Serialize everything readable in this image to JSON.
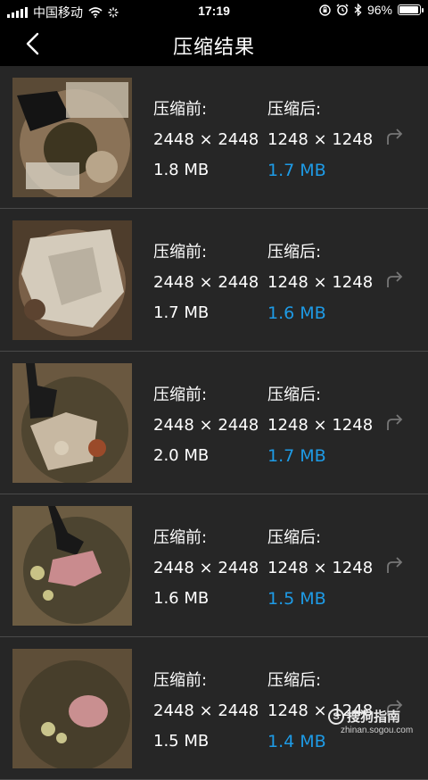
{
  "status_bar": {
    "carrier": "中国移动",
    "time": "17:19",
    "battery": "96%",
    "battery_level": 0.96,
    "icons": [
      "signal-icon",
      "wifi-icon",
      "loading-icon",
      "orientation-lock-icon",
      "alarm-icon",
      "bluetooth-icon",
      "battery-icon"
    ]
  },
  "nav": {
    "title": "压缩结果",
    "back_icon": "chevron-left-icon"
  },
  "results": [
    {
      "before_label": "压缩前:",
      "before_dims": "2448 × 2448",
      "before_size": "1.8 MB",
      "after_label": "压缩后:",
      "after_dims": "1248 × 1248",
      "after_size": "1.7 MB"
    },
    {
      "before_label": "压缩前:",
      "before_dims": "2448 × 2448",
      "before_size": "1.7 MB",
      "after_label": "压缩后:",
      "after_dims": "1248 × 1248",
      "after_size": "1.6 MB"
    },
    {
      "before_label": "压缩前:",
      "before_dims": "2448 × 2448",
      "before_size": "2.0 MB",
      "after_label": "压缩后:",
      "after_dims": "1248 × 1248",
      "after_size": "1.7 MB"
    },
    {
      "before_label": "压缩前:",
      "before_dims": "2448 × 2448",
      "before_size": "1.6 MB",
      "after_label": "压缩后:",
      "after_dims": "1248 × 1248",
      "after_size": "1.5 MB"
    },
    {
      "before_label": "压缩前:",
      "before_dims": "2448 × 2448",
      "before_size": "1.5 MB",
      "after_label": "压缩后:",
      "after_dims": "1248 × 1248",
      "after_size": "1.4 MB"
    }
  ],
  "watermark": {
    "logo_char": "S",
    "name": "搜狗指南",
    "url": "zhinan.sogou.com"
  },
  "colors": {
    "background": "#262626",
    "bar": "#000000",
    "accent": "#1e9be6",
    "divider": "#4a4a4a"
  }
}
